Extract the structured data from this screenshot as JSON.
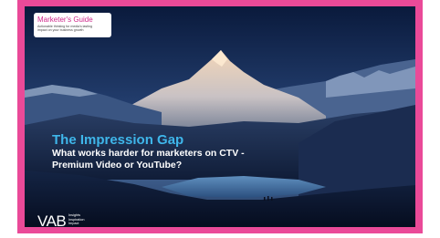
{
  "brand": {
    "frame_color": "#ea4a98",
    "accent": "#3fb6ea"
  },
  "guide": {
    "title": "Marketer's Guide",
    "subtitle": "Actionable thinking for media's lasting impact on your business growth"
  },
  "headline": {
    "title": "The Impression Gap",
    "subtitle": "What works harder for marketers on CTV - Premium Video or YouTube?"
  },
  "logo": {
    "mark": "VAB",
    "taglines": [
      "Insights",
      "Inspiration",
      "Impact"
    ]
  }
}
